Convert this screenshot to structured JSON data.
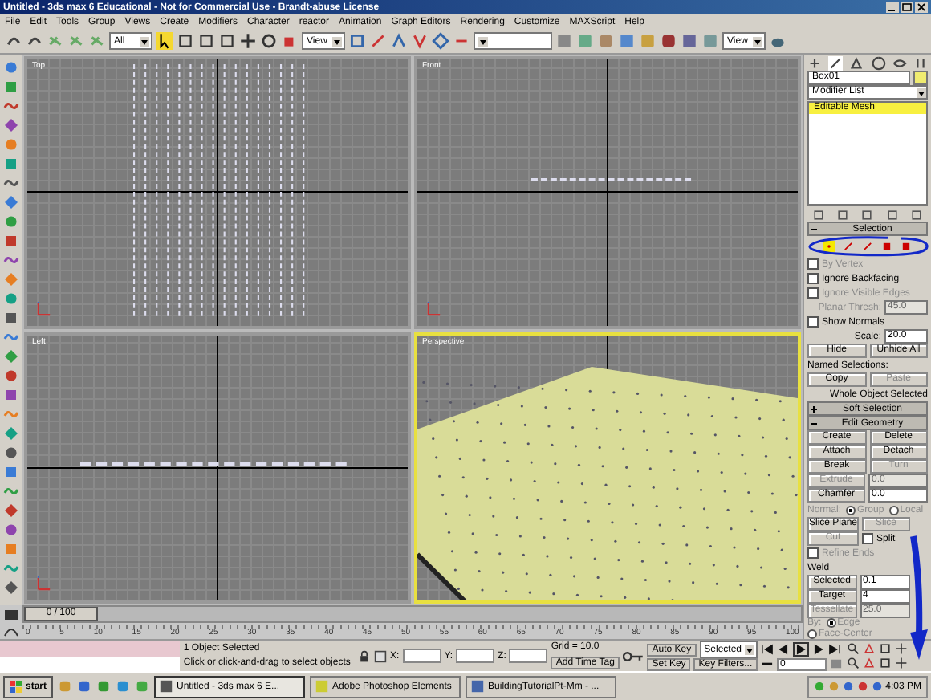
{
  "window": {
    "title": "Untitled - 3ds max 6 Educational - Not for Commercial Use - Brandt-abuse License"
  },
  "menu": [
    "File",
    "Edit",
    "Tools",
    "Group",
    "Views",
    "Create",
    "Modifiers",
    "Character",
    "reactor",
    "Animation",
    "Graph Editors",
    "Rendering",
    "Customize",
    "MAXScript",
    "Help"
  ],
  "toolbar": {
    "selection_filter": "All",
    "reference_coord": "View",
    "render_type": "View"
  },
  "viewports": [
    {
      "label": "Top",
      "kind": "top",
      "selected": false
    },
    {
      "label": "Front",
      "kind": "front",
      "selected": false
    },
    {
      "label": "Left",
      "kind": "left",
      "selected": false
    },
    {
      "label": "Perspective",
      "kind": "perspective",
      "selected": true
    }
  ],
  "command_panel": {
    "rows": [
      {
        "kind": "field",
        "value": "Box01"
      },
      {
        "kind": "dropdown",
        "value": "Modifier List"
      },
      {
        "kind": "stack",
        "items": [
          {
            "label": "Editable Mesh",
            "selected": true
          }
        ]
      },
      {
        "kind": "stack_tools"
      },
      {
        "kind": "header",
        "label": "Selection",
        "expanded": true
      },
      {
        "kind": "subobjects",
        "items": [
          {
            "selected": true
          },
          {
            "selected": false
          },
          {
            "selected": false
          },
          {
            "selected": false
          },
          {
            "selected": false
          }
        ]
      },
      {
        "kind": "check",
        "label": "By Vertex",
        "checked": false,
        "disabled": true
      },
      {
        "kind": "check",
        "label": "Ignore Backfacing",
        "checked": false,
        "disabled": false
      },
      {
        "kind": "check",
        "label": "Ignore Visible Edges",
        "checked": false,
        "disabled": true
      },
      {
        "kind": "spinner",
        "label": "Planar Thresh:",
        "value": "45.0",
        "disabled": true
      },
      {
        "kind": "check",
        "label": "Show Normals",
        "checked": false,
        "disabled": false
      },
      {
        "kind": "spinner",
        "label": "Scale:",
        "value": "20.0",
        "disabled": false
      },
      {
        "kind": "buttons",
        "items": [
          {
            "kind": "button",
            "label": "Hide",
            "disabled": false
          },
          {
            "kind": "button",
            "label": "Unhide All",
            "disabled": false
          }
        ]
      },
      {
        "kind": "label",
        "text": "Named Selections:"
      },
      {
        "kind": "buttons",
        "items": [
          {
            "kind": "button",
            "label": "Copy",
            "disabled": false
          },
          {
            "kind": "button",
            "label": "Paste",
            "disabled": true
          }
        ]
      },
      {
        "kind": "note",
        "text": "Whole Object Selected"
      },
      {
        "kind": "header",
        "label": "Soft Selection",
        "expanded": false
      },
      {
        "kind": "header",
        "label": "Edit Geometry",
        "expanded": true
      },
      {
        "kind": "buttons",
        "items": [
          {
            "kind": "button",
            "label": "Create",
            "disabled": false
          },
          {
            "kind": "button",
            "label": "Delete",
            "disabled": false
          }
        ]
      },
      {
        "kind": "buttons",
        "items": [
          {
            "kind": "button",
            "label": "Attach",
            "disabled": false
          },
          {
            "kind": "button",
            "label": "Detach",
            "disabled": false
          }
        ]
      },
      {
        "kind": "buttons",
        "items": [
          {
            "kind": "button",
            "label": "Break",
            "disabled": false
          },
          {
            "kind": "button",
            "label": "Turn",
            "disabled": true
          }
        ]
      },
      {
        "kind": "spinbutton",
        "label": "Extrude",
        "value": "0.0",
        "disabled": true
      },
      {
        "kind": "spinbutton",
        "label": "Chamfer",
        "value": "0.0",
        "disabled": false
      },
      {
        "kind": "radios",
        "label": "Normal:",
        "disabled": true,
        "options": [
          {
            "label": "Group",
            "selected": true
          },
          {
            "label": "Local",
            "selected": false
          }
        ]
      },
      {
        "kind": "buttons",
        "items": [
          {
            "kind": "button",
            "label": "Slice Plane",
            "disabled": false
          },
          {
            "kind": "button",
            "label": "Slice",
            "disabled": true
          }
        ]
      },
      {
        "kind": "buttons",
        "items": [
          {
            "kind": "button",
            "label": "Cut",
            "disabled": true
          },
          {
            "kind": "check",
            "label": "Split",
            "checked": false,
            "disabled": false
          }
        ]
      },
      {
        "kind": "check",
        "label": "Refine Ends",
        "checked": false,
        "disabled": true
      },
      {
        "kind": "label",
        "text": "Weld"
      },
      {
        "kind": "spinbutton",
        "label": "Selected",
        "value": "0.1",
        "disabled": false
      },
      {
        "kind": "spinbutton",
        "label": "Target",
        "value": "4",
        "disabled": false
      },
      {
        "kind": "spinbutton",
        "label": "Tessellate",
        "value": "25.0",
        "disabled": true
      },
      {
        "kind": "radios",
        "label": "By:",
        "disabled": true,
        "options": [
          {
            "label": "Edge",
            "selected": true
          },
          {
            "label": "Face-Center",
            "selected": false
          }
        ]
      }
    ]
  },
  "time_slider": {
    "position": "0 / 100",
    "level": 0
  },
  "track_bar": {
    "ticks": [
      "0",
      "5",
      "10",
      "15",
      "20",
      "25",
      "30",
      "35",
      "40",
      "45",
      "50",
      "55",
      "60",
      "65",
      "70",
      "75",
      "80",
      "85",
      "90",
      "95",
      "100"
    ]
  },
  "status": {
    "selection": "1 Object Selected",
    "prompt": "Click or click-and-drag to select objects",
    "x_label": "X:",
    "y_label": "Y:",
    "z_label": "Z:",
    "grid": "Grid = 10.0",
    "add_time_tag": "Add Time Tag"
  },
  "animation": {
    "auto_key": "Auto Key",
    "set_key": "Set Key",
    "key_mode": "Selected",
    "key_filters": "Key Filters...",
    "frame": "0"
  },
  "taskbar": {
    "start": "start",
    "tasks": [
      "Untitled - 3ds max 6 E...",
      "Adobe Photoshop Elements",
      "BuildingTutorialPt-Mm - ..."
    ],
    "clock": "4:03 PM"
  }
}
